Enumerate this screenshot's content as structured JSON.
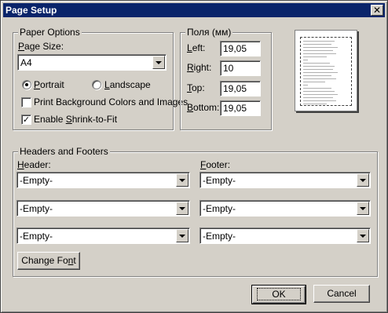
{
  "window": {
    "title": "Page Setup",
    "close_glyph": "✕"
  },
  "paper_options": {
    "legend": "Paper Options",
    "page_size_label_ul": "P",
    "page_size_label_rest": "age Size:",
    "page_size_value": "A4",
    "orientation": {
      "portrait_ul": "P",
      "portrait_rest": "ortrait",
      "landscape_ul": "L",
      "landscape_rest": "andscape",
      "selected": "portrait"
    },
    "print_background_label": "Print Background Colors and Images",
    "print_background_checked": false,
    "enable_shrink_label_pre": "Enable ",
    "enable_shrink_label_ul": "S",
    "enable_shrink_label_rest": "hrink-to-Fit",
    "enable_shrink_checked": true,
    "check_glyph": "✓"
  },
  "margins": {
    "legend": "Поля (мм)",
    "left_ul": "L",
    "left_rest": "eft:",
    "left_value": "19,05",
    "right_ul": "R",
    "right_rest": "ight:",
    "right_value": "10",
    "top_ul": "T",
    "top_rest": "op:",
    "top_value": "19,05",
    "bottom_ul": "B",
    "bottom_rest": "ottom:",
    "bottom_value": "19,05"
  },
  "headers_footers": {
    "legend": "Headers and Footers",
    "header_ul": "H",
    "header_rest": "eader:",
    "footer_ul": "F",
    "footer_rest": "ooter:",
    "header_values": [
      "-Empty-",
      "-Empty-",
      "-Empty-"
    ],
    "footer_values": [
      "-Empty-",
      "-Empty-",
      "-Empty-"
    ],
    "change_font_pre": "Change Fo",
    "change_font_ul": "n",
    "change_font_rest": "t"
  },
  "buttons": {
    "ok": "OK",
    "cancel": "Cancel"
  }
}
